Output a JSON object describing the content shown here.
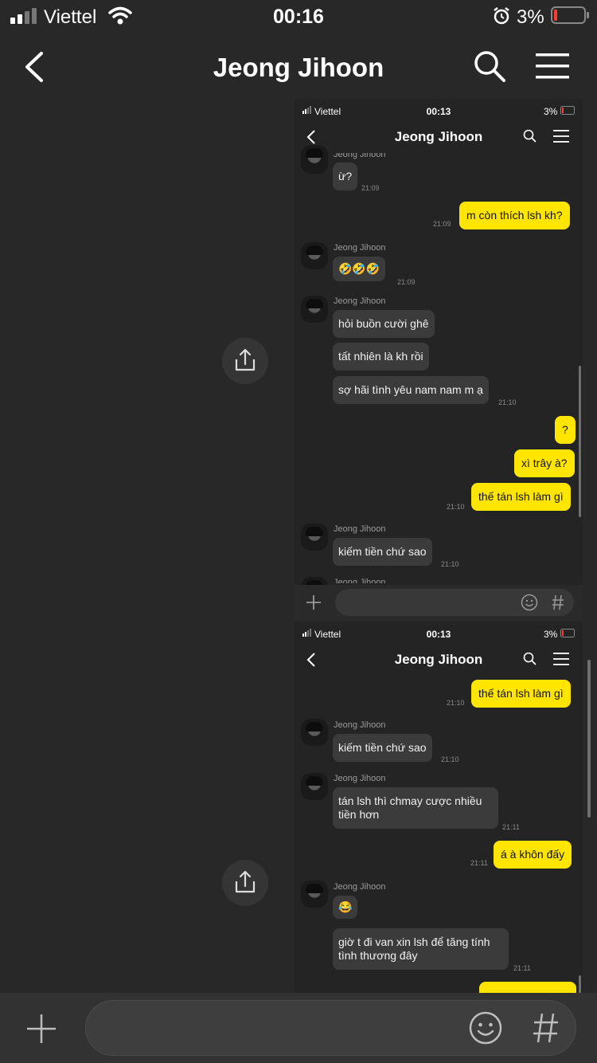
{
  "status_bar": {
    "carrier": "Viettel",
    "time": "00:16",
    "battery": "3%"
  },
  "header": {
    "title": "Jeong Jihoon"
  },
  "shot1": {
    "status": {
      "carrier": "Viettel",
      "time": "00:13",
      "battery": "3%"
    },
    "title": "Jeong Jihoon",
    "partial_name_top": "Jeong Jihoon",
    "bubble_u": "ừ?",
    "ts_u": "21:09",
    "out1": "m còn thích lsh kh?",
    "ts_out1": "21:09",
    "name_a": "Jeong Jihoon",
    "emoji_msg": "🤣🤣🤣",
    "ts_emoji": "21:09",
    "name_b": "Jeong Jihoon",
    "in_b1": "hỏi buồn cười ghê",
    "in_b2": "tất nhiên là kh rồi",
    "in_b3": "sợ hãi tình yêu nam nam m ạ",
    "ts_b": "21:10",
    "out2": "?",
    "out3": "xì trây à?",
    "out4": "thế tán lsh làm gì",
    "ts_out4": "21:10",
    "name_c": "Jeong Jihoon",
    "in_c": "kiếm tiền chứ sao",
    "ts_c": "21:10",
    "partial_name_bottom": "Jeong Jihoon"
  },
  "shot2": {
    "status": {
      "carrier": "Viettel",
      "time": "00:13",
      "battery": "3%"
    },
    "title": "Jeong Jihoon",
    "out1": "thế tán lsh làm gì",
    "ts_out1": "21:10",
    "name_a": "Jeong Jihoon",
    "in_a": "kiếm tiền chứ sao",
    "ts_a": "21:10",
    "name_b": "Jeong Jihoon",
    "in_b_l1": "tán lsh thì chmay cược nhiều",
    "in_b_l2": "tiền hơn",
    "ts_b": "21:11",
    "out2": "á à khôn đấy",
    "ts_out2": "21:11",
    "name_c": "Jeong Jihoon",
    "emoji_c": "😂",
    "in_c_l1": "giờ t đi van xin lsh để tăng tính",
    "in_c_l2": "tình thương đây",
    "ts_c": "21:11"
  },
  "input": {
    "hash": "#"
  },
  "colors": {
    "background": "#282828",
    "outgoing_bubble": "#ffe500",
    "incoming_bubble": "#3b3b3b"
  },
  "icons": [
    "back-icon",
    "search-icon",
    "menu-icon",
    "share-icon",
    "plus-icon",
    "emoji-icon",
    "hash-icon"
  ]
}
